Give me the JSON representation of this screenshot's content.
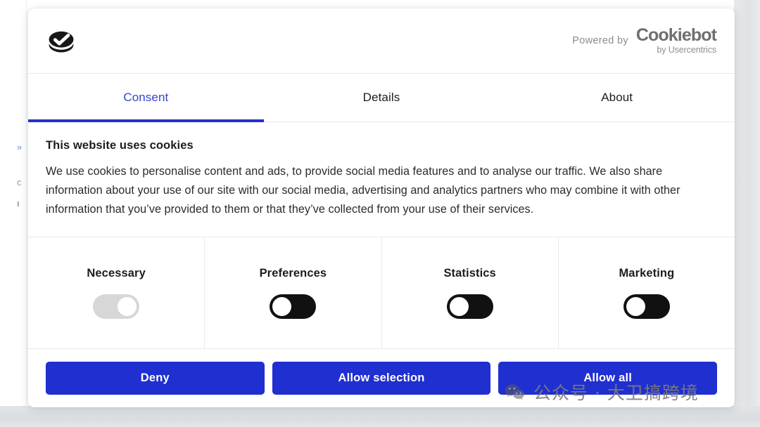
{
  "dialog": {
    "header": {
      "logo_icon": "cookie-check-icon",
      "powered_by_label": "Powered by",
      "brand_name": "Cookiebot",
      "brand_sub": "by Usercentrics"
    },
    "tabs": [
      {
        "label": "Consent",
        "active": true
      },
      {
        "label": "Details",
        "active": false
      },
      {
        "label": "About",
        "active": false
      }
    ],
    "body": {
      "title": "This website uses cookies",
      "text": "We use cookies to personalise content and ads, to provide social media features and to analyse our traffic. We also share information about your use of our site with our social media, advertising and analytics partners who may combine it with other information that you’ve provided to them or that they’ve collected from your use of their services."
    },
    "categories": [
      {
        "label": "Necessary",
        "state": "on",
        "disabled": true
      },
      {
        "label": "Preferences",
        "state": "off",
        "disabled": false
      },
      {
        "label": "Statistics",
        "state": "off",
        "disabled": false
      },
      {
        "label": "Marketing",
        "state": "off",
        "disabled": false
      }
    ],
    "actions": [
      {
        "label": "Deny"
      },
      {
        "label": "Allow selection"
      },
      {
        "label": "Allow all"
      }
    ]
  },
  "watermark": {
    "icon": "wechat-icon",
    "text": "公众号 · 大卫搞跨境"
  },
  "background": {
    "ghost_line_1": "»",
    "ghost_line_2": "с",
    "ghost_line_3": "ı"
  },
  "colors": {
    "accent_blue": "#1f2fd0",
    "tab_active_text": "#3344cc",
    "toggle_on": "#111111",
    "toggle_disabled": "#d7d7d7",
    "text_primary": "#1d1d1f",
    "muted": "#8d8d8d"
  }
}
